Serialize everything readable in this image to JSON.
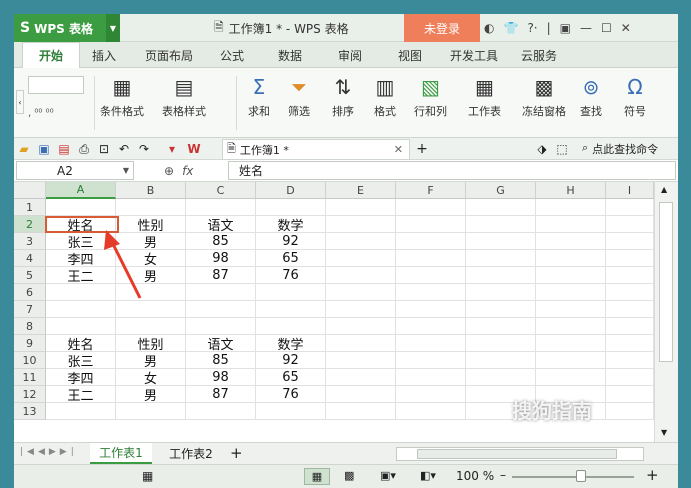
{
  "app": {
    "name": "WPS 表格",
    "doc_title": "工作簿1 * - WPS 表格",
    "login": "未登录"
  },
  "tabs": [
    "开始",
    "插入",
    "页面布局",
    "公式",
    "数据",
    "审阅",
    "视图",
    "开发工具",
    "云服务"
  ],
  "ribbon": [
    "条件格式",
    "表格样式",
    "求和",
    "筛选",
    "排序",
    "格式",
    "行和列",
    "工作表",
    "冻结窗格",
    "查找",
    "符号"
  ],
  "doc_tab": "工作簿1 *",
  "search_cmd": "点此查找命令",
  "namebox": "A2",
  "formula": "姓名",
  "columns": [
    "A",
    "B",
    "C",
    "D",
    "E",
    "F",
    "G",
    "H",
    "I"
  ],
  "rows": [
    "1",
    "2",
    "3",
    "4",
    "5",
    "6",
    "7",
    "8",
    "9",
    "10",
    "11",
    "12",
    "13"
  ],
  "table1": [
    [
      "姓名",
      "性别",
      "语文",
      "数学"
    ],
    [
      "张三",
      "男",
      "85",
      "92"
    ],
    [
      "李四",
      "女",
      "98",
      "65"
    ],
    [
      "王二",
      "男",
      "87",
      "76"
    ]
  ],
  "table2": [
    [
      "姓名",
      "性别",
      "语文",
      "数学"
    ],
    [
      "张三",
      "男",
      "85",
      "92"
    ],
    [
      "李四",
      "女",
      "98",
      "65"
    ],
    [
      "王二",
      "男",
      "87",
      "76"
    ]
  ],
  "sheets": [
    "工作表1",
    "工作表2"
  ],
  "zoom": "100 %",
  "watermark": {
    "brand": "搜狗指南",
    "url": "zhinan.sogou.com"
  },
  "colors": {
    "brand_green": "#3c9c42",
    "login_orange": "#ee7f5a",
    "select_red": "#d95a36"
  }
}
